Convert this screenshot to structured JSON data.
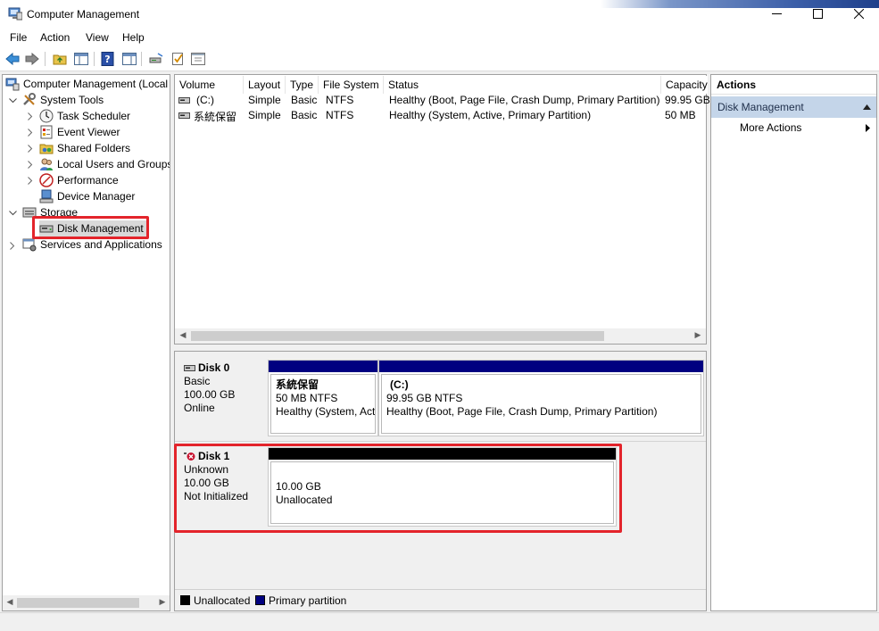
{
  "window": {
    "title": "Computer Management"
  },
  "menu": [
    "File",
    "Action",
    "View",
    "Help"
  ],
  "tree": {
    "root": "Computer Management (Local",
    "system_tools": "System Tools",
    "task_scheduler": "Task Scheduler",
    "event_viewer": "Event Viewer",
    "shared_folders": "Shared Folders",
    "local_users": "Local Users and Groups",
    "performance": "Performance",
    "device_manager": "Device Manager",
    "storage": "Storage",
    "disk_management": "Disk Management",
    "services": "Services and Applications"
  },
  "volume_list": {
    "columns": [
      "Volume",
      "Layout",
      "Type",
      "File System",
      "Status",
      "Capacity"
    ],
    "rows": [
      {
        "volume": "(C:)",
        "layout": "Simple",
        "type": "Basic",
        "fs": "NTFS",
        "status": "Healthy (Boot, Page File, Crash Dump, Primary Partition)",
        "capacity": "99.95 GB"
      },
      {
        "volume": "系統保留",
        "layout": "Simple",
        "type": "Basic",
        "fs": "NTFS",
        "status": "Healthy (System, Active, Primary Partition)",
        "capacity": "50 MB"
      }
    ]
  },
  "disks": [
    {
      "name": "Disk 0",
      "type": "Basic",
      "size": "100.00 GB",
      "state": "Online",
      "partitions": [
        {
          "title": "系統保留",
          "size": "50 MB NTFS",
          "status": "Healthy (System, Act"
        },
        {
          "title": "(C:)",
          "size": "99.95 GB NTFS",
          "status": "Healthy (Boot, Page File, Crash Dump, Primary Partition)"
        }
      ]
    },
    {
      "name": "Disk 1",
      "type": "Unknown",
      "size": "10.00 GB",
      "state": "Not Initialized",
      "partitions": [
        {
          "size": "10.00 GB",
          "status": "Unallocated"
        }
      ]
    }
  ],
  "legend": {
    "unallocated": "Unallocated",
    "primary": "Primary partition"
  },
  "actions": {
    "header": "Actions",
    "section": "Disk Management",
    "more": "More Actions"
  },
  "colors": {
    "primary_partition": "#000080",
    "unallocated": "#000000",
    "highlight": "#e3242b",
    "action_section": "#c4d5e9"
  }
}
